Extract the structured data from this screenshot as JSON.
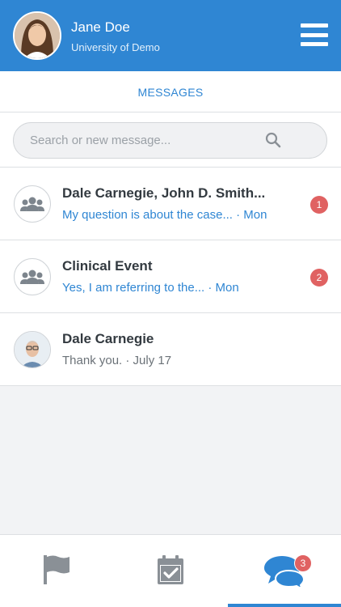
{
  "header": {
    "user_name": "Jane Doe",
    "organization": "University of Demo",
    "menu_icon": "hamburger-menu-icon"
  },
  "tabs": {
    "active_label": "MESSAGES"
  },
  "search": {
    "placeholder": "Search or new message...",
    "value": "",
    "icon": "search-icon"
  },
  "conversations": [
    {
      "title": "Dale Carnegie, John D. Smith...",
      "preview": "My question is about the case... · Mon",
      "avatar": "group-icon",
      "unread": true,
      "unread_count": "1"
    },
    {
      "title": "Clinical Event",
      "preview": "Yes, I am referring to the... · Mon",
      "avatar": "group-icon",
      "unread": true,
      "unread_count": "2"
    },
    {
      "title": "Dale Carnegie",
      "preview": "Thank you. · July 17",
      "avatar": "user-photo",
      "unread": false,
      "unread_count": ""
    }
  ],
  "bottom_nav": {
    "items": [
      {
        "icon": "flag-icon",
        "active": false
      },
      {
        "icon": "calendar-check-icon",
        "active": false
      },
      {
        "icon": "chat-bubbles-icon",
        "active": true,
        "badge": "3"
      }
    ]
  },
  "colors": {
    "brand": "#2f86d3",
    "badge": "#e06262",
    "background": "#f2f3f5"
  }
}
